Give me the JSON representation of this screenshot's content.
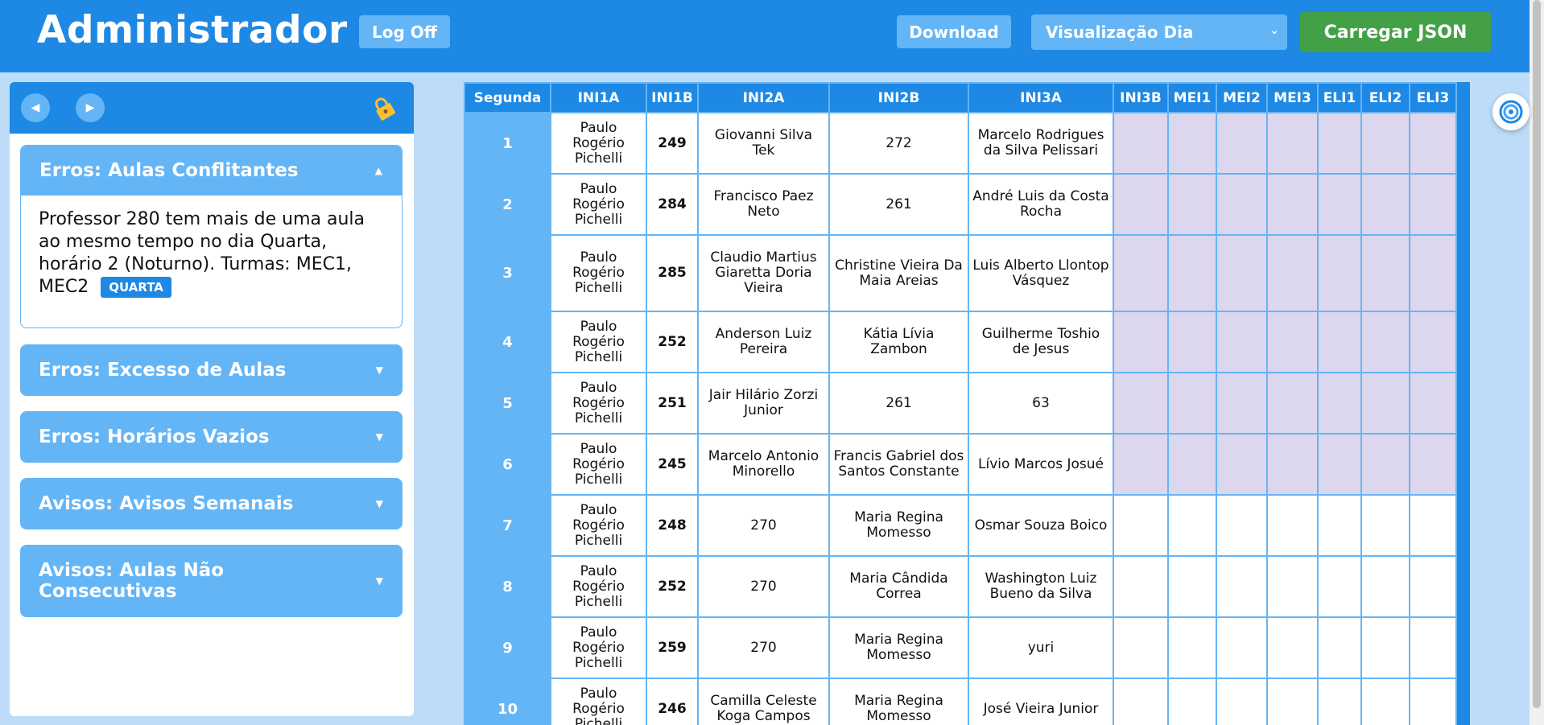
{
  "header": {
    "title": "Administrador",
    "logoff_label": "Log Off",
    "download_label": "Download",
    "view_select": "Visualização Dia",
    "load_json_label": "Carregar JSON"
  },
  "sidebar": {
    "accordions": [
      {
        "title": "Erros: Aulas Conflitantes",
        "open": true,
        "message": "Professor 280 tem mais de uma aula ao mesmo tempo no dia Quarta, horário 2 (Noturno). Turmas: MEC1, MEC2",
        "badge": "QUARTA"
      },
      {
        "title": "Erros: Excesso de Aulas",
        "open": false
      },
      {
        "title": "Erros: Horários Vazios",
        "open": false
      },
      {
        "title": "Avisos: Avisos Semanais",
        "open": false
      },
      {
        "title": "Avisos: Aulas Não Consecutivas",
        "open": false
      }
    ]
  },
  "schedule": {
    "day_label": "Segunda",
    "columns": [
      "INI1A",
      "INI1B",
      "INI2A",
      "INI2B",
      "INI3A",
      "INI3B",
      "MEI1",
      "MEI2",
      "MEI3",
      "ELI1",
      "ELI2",
      "ELI3"
    ],
    "rows": [
      {
        "n": "1",
        "cells": [
          "Paulo Rogério Pichelli",
          "249",
          "Giovanni Silva Tek",
          "272",
          "Marcelo Rodrigues da Silva Pelissari"
        ]
      },
      {
        "n": "2",
        "cells": [
          "Paulo Rogério Pichelli",
          "284",
          "Francisco Paez Neto",
          "261",
          "André Luis da Costa Rocha"
        ]
      },
      {
        "n": "3",
        "cells": [
          "Paulo Rogério Pichelli",
          "285",
          "Claudio Martius Giaretta Doria Vieira",
          "Christine Vieira Da Maia Areias",
          "Luis Alberto Llontop Vásquez"
        ]
      },
      {
        "n": "4",
        "cells": [
          "Paulo Rogério Pichelli",
          "252",
          "Anderson Luiz Pereira",
          "Kátia Lívia Zambon",
          "Guilherme Toshio de Jesus"
        ]
      },
      {
        "n": "5",
        "cells": [
          "Paulo Rogério Pichelli",
          "251",
          "Jair Hilário Zorzi Junior",
          "261",
          "63"
        ]
      },
      {
        "n": "6",
        "cells": [
          "Paulo Rogério Pichelli",
          "245",
          "Marcelo Antonio Minorello",
          "Francis Gabriel dos Santos Constante",
          "Lívio Marcos Josué"
        ]
      },
      {
        "n": "7",
        "cells": [
          "Paulo Rogério Pichelli",
          "248",
          "270",
          "Maria Regina Momesso",
          "Osmar Souza Boico"
        ]
      },
      {
        "n": "8",
        "cells": [
          "Paulo Rogério Pichelli",
          "252",
          "270",
          "Maria Cândida Correa",
          "Washington Luiz Bueno da Silva"
        ]
      },
      {
        "n": "9",
        "cells": [
          "Paulo Rogério Pichelli",
          "259",
          "270",
          "Maria Regina Momesso",
          "yuri"
        ]
      },
      {
        "n": "10",
        "cells": [
          "Paulo Rogério Pichelli",
          "246",
          "Camilla Celeste Koga Campos",
          "Maria Regina Momesso",
          "José Vieira Junior"
        ]
      }
    ],
    "shaded_rows": 6,
    "colors": {
      "header": "#1e88e5",
      "accent": "#64b5f6",
      "shaded": "#dcd6ee",
      "green": "#43a047"
    }
  }
}
